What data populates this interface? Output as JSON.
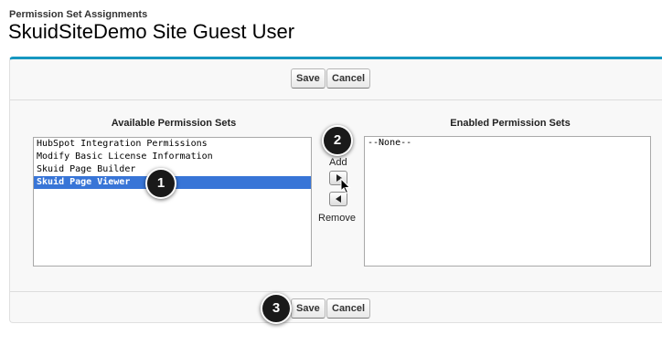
{
  "header": {
    "subtitle": "Permission Set Assignments",
    "title": "SkuidSiteDemo Site Guest User"
  },
  "top_buttons": {
    "save": "Save",
    "cancel": "Cancel"
  },
  "bottom_buttons": {
    "save": "Save",
    "cancel": "Cancel"
  },
  "available": {
    "heading": "Available Permission Sets",
    "items": [
      {
        "label": "HubSpot Integration Permissions",
        "selected": false
      },
      {
        "label": "Modify Basic License Information",
        "selected": false
      },
      {
        "label": "Skuid Page Builder",
        "selected": false
      },
      {
        "label": "Skuid Page Viewer",
        "selected": true
      }
    ]
  },
  "enabled": {
    "heading": "Enabled Permission Sets",
    "items": [
      {
        "label": "--None--"
      }
    ]
  },
  "transfer": {
    "add_label": "Add",
    "remove_label": "Remove",
    "add_icon": "arrow-right-icon",
    "remove_icon": "arrow-left-icon"
  },
  "callouts": {
    "one": "1",
    "two": "2",
    "three": "3"
  },
  "colors": {
    "accent": "#1797c0",
    "selection": "#3875d7",
    "callout": "#1a1a1a"
  }
}
